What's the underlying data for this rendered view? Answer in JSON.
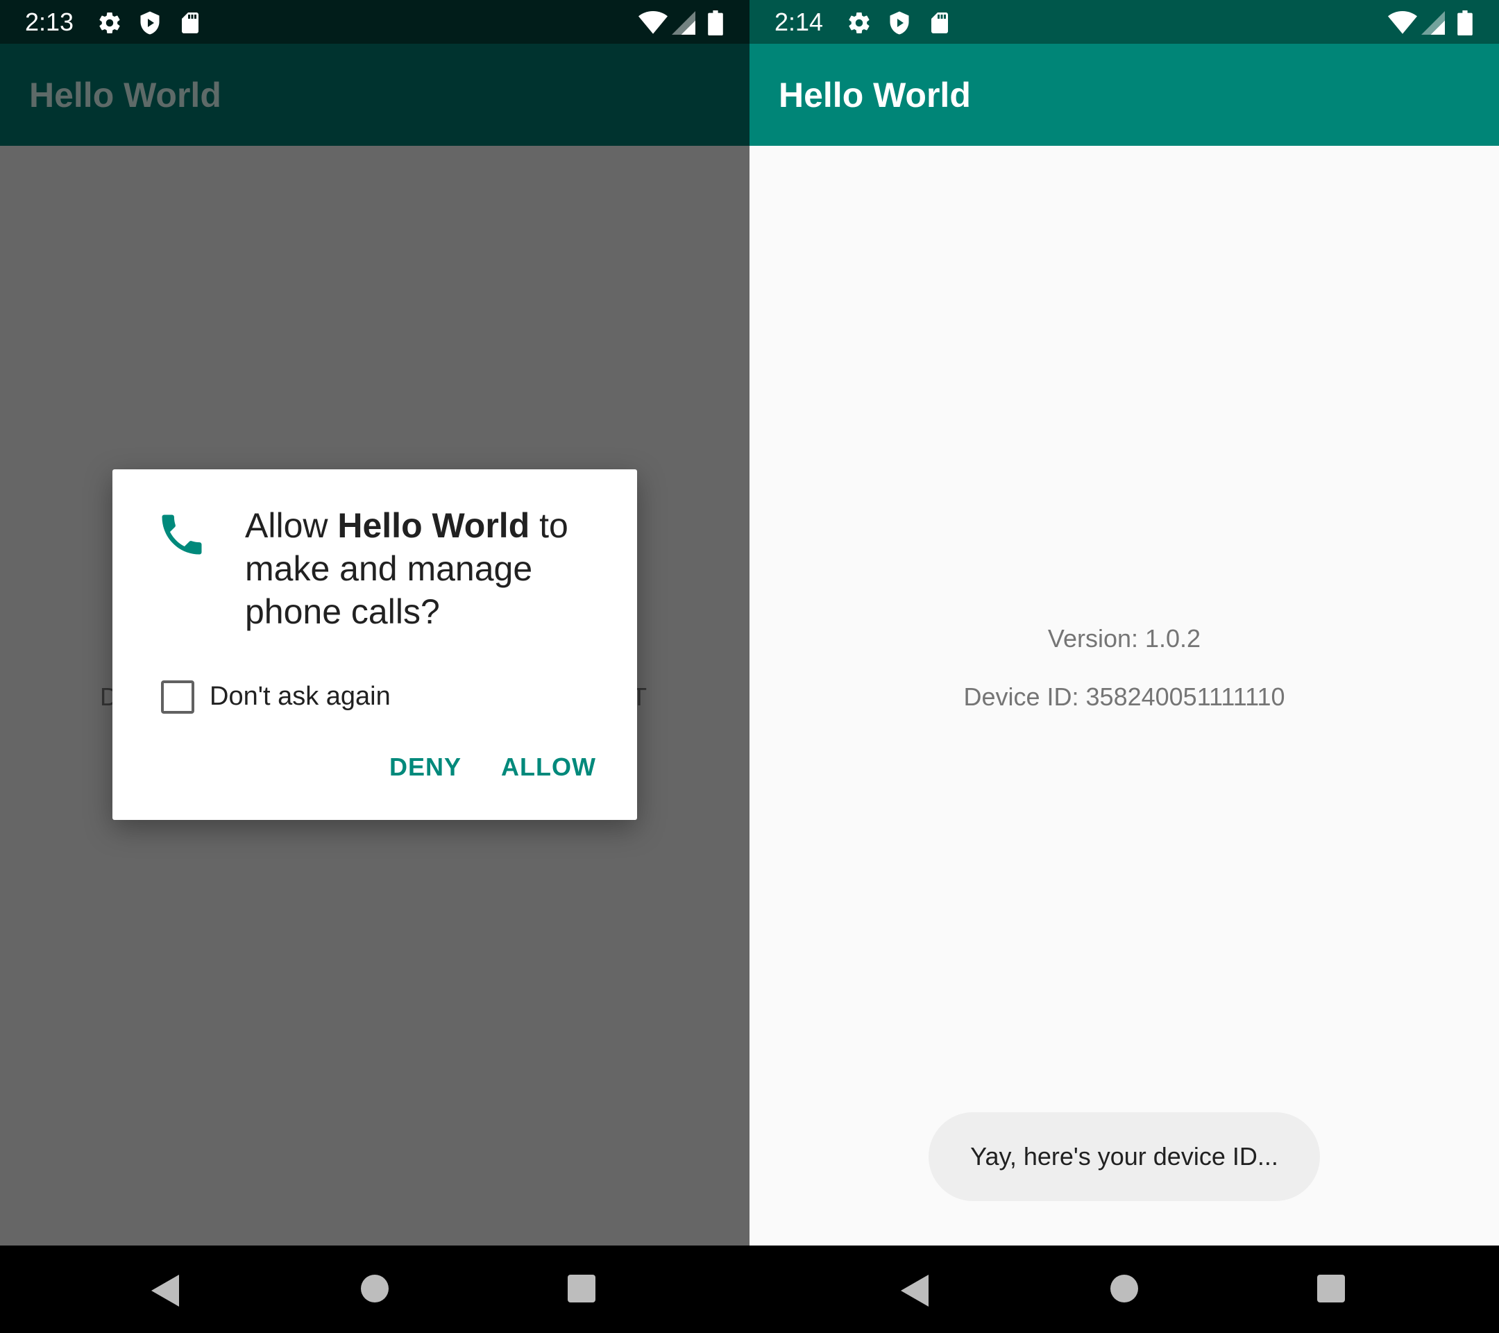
{
  "left": {
    "status": {
      "time": "2:13"
    },
    "appbar": {
      "title": "Hello World"
    },
    "colors": {
      "statusbar": "#011d1a",
      "appbar": "#00332f",
      "scrim": "#666666"
    },
    "background_text": {
      "left_char": "D",
      "right_char": "T"
    },
    "dialog": {
      "prefix": "Allow ",
      "app_name": "Hello World",
      "suffix": " to make and manage phone calls?",
      "icon": "phone-icon",
      "checkbox_label": "Don't ask again",
      "checkbox_checked": false,
      "deny_label": "DENY",
      "allow_label": "ALLOW",
      "accent": "#00897b"
    }
  },
  "right": {
    "status": {
      "time": "2:14"
    },
    "appbar": {
      "title": "Hello World"
    },
    "colors": {
      "statusbar": "#00574b",
      "appbar": "#008577",
      "background": "#fafafa"
    },
    "content": {
      "version": "Version: 1.0.2",
      "device_id": "Device ID: 358240051111110"
    },
    "toast": {
      "text": "Yay, here's your device ID..."
    }
  },
  "status_icons": [
    "settings-icon",
    "shield-play-icon",
    "sd-card-icon",
    "wifi-icon",
    "signal-icon",
    "battery-icon"
  ],
  "nav_icons": [
    "back-icon",
    "home-icon",
    "recents-icon"
  ]
}
